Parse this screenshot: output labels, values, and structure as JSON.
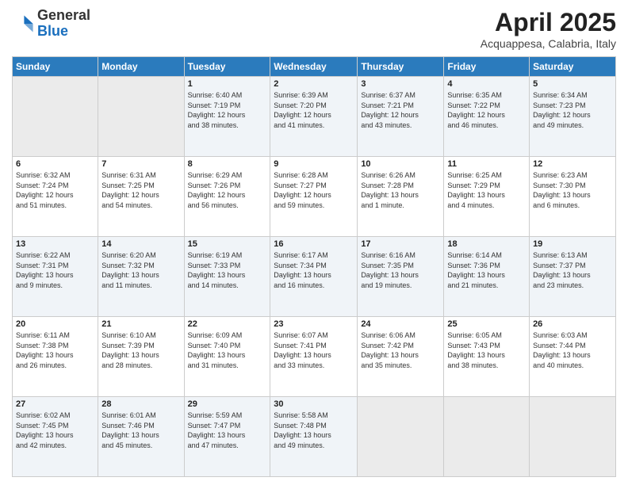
{
  "header": {
    "logo_line1": "General",
    "logo_line2": "Blue",
    "title": "April 2025",
    "location": "Acquappesa, Calabria, Italy"
  },
  "weekdays": [
    "Sunday",
    "Monday",
    "Tuesday",
    "Wednesday",
    "Thursday",
    "Friday",
    "Saturday"
  ],
  "weeks": [
    [
      {
        "day": "",
        "info": ""
      },
      {
        "day": "",
        "info": ""
      },
      {
        "day": "1",
        "info": "Sunrise: 6:40 AM\nSunset: 7:19 PM\nDaylight: 12 hours\nand 38 minutes."
      },
      {
        "day": "2",
        "info": "Sunrise: 6:39 AM\nSunset: 7:20 PM\nDaylight: 12 hours\nand 41 minutes."
      },
      {
        "day": "3",
        "info": "Sunrise: 6:37 AM\nSunset: 7:21 PM\nDaylight: 12 hours\nand 43 minutes."
      },
      {
        "day": "4",
        "info": "Sunrise: 6:35 AM\nSunset: 7:22 PM\nDaylight: 12 hours\nand 46 minutes."
      },
      {
        "day": "5",
        "info": "Sunrise: 6:34 AM\nSunset: 7:23 PM\nDaylight: 12 hours\nand 49 minutes."
      }
    ],
    [
      {
        "day": "6",
        "info": "Sunrise: 6:32 AM\nSunset: 7:24 PM\nDaylight: 12 hours\nand 51 minutes."
      },
      {
        "day": "7",
        "info": "Sunrise: 6:31 AM\nSunset: 7:25 PM\nDaylight: 12 hours\nand 54 minutes."
      },
      {
        "day": "8",
        "info": "Sunrise: 6:29 AM\nSunset: 7:26 PM\nDaylight: 12 hours\nand 56 minutes."
      },
      {
        "day": "9",
        "info": "Sunrise: 6:28 AM\nSunset: 7:27 PM\nDaylight: 12 hours\nand 59 minutes."
      },
      {
        "day": "10",
        "info": "Sunrise: 6:26 AM\nSunset: 7:28 PM\nDaylight: 13 hours\nand 1 minute."
      },
      {
        "day": "11",
        "info": "Sunrise: 6:25 AM\nSunset: 7:29 PM\nDaylight: 13 hours\nand 4 minutes."
      },
      {
        "day": "12",
        "info": "Sunrise: 6:23 AM\nSunset: 7:30 PM\nDaylight: 13 hours\nand 6 minutes."
      }
    ],
    [
      {
        "day": "13",
        "info": "Sunrise: 6:22 AM\nSunset: 7:31 PM\nDaylight: 13 hours\nand 9 minutes."
      },
      {
        "day": "14",
        "info": "Sunrise: 6:20 AM\nSunset: 7:32 PM\nDaylight: 13 hours\nand 11 minutes."
      },
      {
        "day": "15",
        "info": "Sunrise: 6:19 AM\nSunset: 7:33 PM\nDaylight: 13 hours\nand 14 minutes."
      },
      {
        "day": "16",
        "info": "Sunrise: 6:17 AM\nSunset: 7:34 PM\nDaylight: 13 hours\nand 16 minutes."
      },
      {
        "day": "17",
        "info": "Sunrise: 6:16 AM\nSunset: 7:35 PM\nDaylight: 13 hours\nand 19 minutes."
      },
      {
        "day": "18",
        "info": "Sunrise: 6:14 AM\nSunset: 7:36 PM\nDaylight: 13 hours\nand 21 minutes."
      },
      {
        "day": "19",
        "info": "Sunrise: 6:13 AM\nSunset: 7:37 PM\nDaylight: 13 hours\nand 23 minutes."
      }
    ],
    [
      {
        "day": "20",
        "info": "Sunrise: 6:11 AM\nSunset: 7:38 PM\nDaylight: 13 hours\nand 26 minutes."
      },
      {
        "day": "21",
        "info": "Sunrise: 6:10 AM\nSunset: 7:39 PM\nDaylight: 13 hours\nand 28 minutes."
      },
      {
        "day": "22",
        "info": "Sunrise: 6:09 AM\nSunset: 7:40 PM\nDaylight: 13 hours\nand 31 minutes."
      },
      {
        "day": "23",
        "info": "Sunrise: 6:07 AM\nSunset: 7:41 PM\nDaylight: 13 hours\nand 33 minutes."
      },
      {
        "day": "24",
        "info": "Sunrise: 6:06 AM\nSunset: 7:42 PM\nDaylight: 13 hours\nand 35 minutes."
      },
      {
        "day": "25",
        "info": "Sunrise: 6:05 AM\nSunset: 7:43 PM\nDaylight: 13 hours\nand 38 minutes."
      },
      {
        "day": "26",
        "info": "Sunrise: 6:03 AM\nSunset: 7:44 PM\nDaylight: 13 hours\nand 40 minutes."
      }
    ],
    [
      {
        "day": "27",
        "info": "Sunrise: 6:02 AM\nSunset: 7:45 PM\nDaylight: 13 hours\nand 42 minutes."
      },
      {
        "day": "28",
        "info": "Sunrise: 6:01 AM\nSunset: 7:46 PM\nDaylight: 13 hours\nand 45 minutes."
      },
      {
        "day": "29",
        "info": "Sunrise: 5:59 AM\nSunset: 7:47 PM\nDaylight: 13 hours\nand 47 minutes."
      },
      {
        "day": "30",
        "info": "Sunrise: 5:58 AM\nSunset: 7:48 PM\nDaylight: 13 hours\nand 49 minutes."
      },
      {
        "day": "",
        "info": ""
      },
      {
        "day": "",
        "info": ""
      },
      {
        "day": "",
        "info": ""
      }
    ]
  ]
}
